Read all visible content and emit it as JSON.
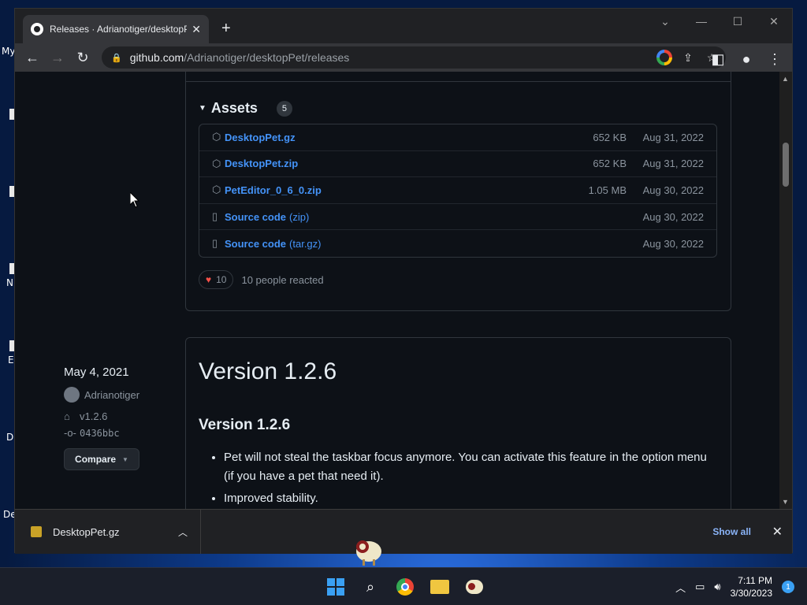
{
  "browser": {
    "tab_title": "Releases · Adrianotiger/desktopPet",
    "url_host": "github.com",
    "url_path": "/Adrianotiger/desktopPet/releases"
  },
  "assets": {
    "title": "Assets",
    "count": "5",
    "items": [
      {
        "name": "DesktopPet.gz",
        "suffix": "",
        "size": "652 KB",
        "date": "Aug 31, 2022",
        "icon": "package-icon"
      },
      {
        "name": "DesktopPet.zip",
        "suffix": "",
        "size": "652 KB",
        "date": "Aug 31, 2022",
        "icon": "package-icon"
      },
      {
        "name": "PetEditor_0_6_0.zip",
        "suffix": "",
        "size": "1.05 MB",
        "date": "Aug 30, 2022",
        "icon": "package-icon"
      },
      {
        "name": "Source code",
        "suffix": "(zip)",
        "size": "",
        "date": "Aug 30, 2022",
        "icon": "file-zip-icon"
      },
      {
        "name": "Source code",
        "suffix": "(tar.gz)",
        "size": "",
        "date": "Aug 30, 2022",
        "icon": "file-zip-icon"
      }
    ]
  },
  "reaction": {
    "count": "10",
    "text": "10 people reacted"
  },
  "release": {
    "date": "May 4, 2021",
    "author": "Adrianotiger",
    "tag": "v1.2.6",
    "commit": "0436bbc",
    "compare_label": "Compare",
    "title": "Version 1.2.6",
    "subtitle": "Version 1.2.6",
    "notes": [
      "Pet will not steal the taskbar focus anymore. You can activate this feature in the option menu (if you have a pet that need it).",
      "Improved stability."
    ]
  },
  "downloads": {
    "file": "DesktopPet.gz",
    "show_all": "Show all"
  },
  "taskbar": {
    "time": "7:11 PM",
    "date": "3/30/2023",
    "notifications": "1"
  },
  "desktop": {
    "labels": [
      "My",
      "N",
      "E",
      "D",
      "De"
    ]
  }
}
